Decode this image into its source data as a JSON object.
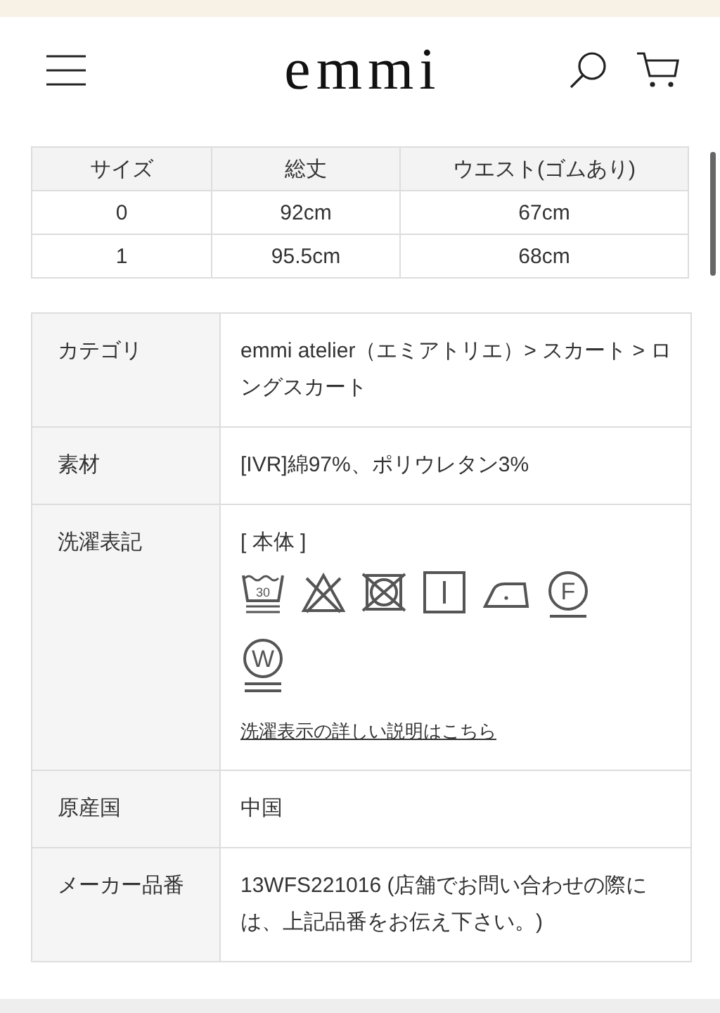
{
  "header": {
    "logo": "emmi"
  },
  "size_table": {
    "columns": [
      "サイズ",
      "総丈",
      "ウエスト(ゴムあり)"
    ],
    "rows": [
      [
        "0",
        "92cm",
        "67cm"
      ],
      [
        "1",
        "95.5cm",
        "68cm"
      ]
    ]
  },
  "details": [
    {
      "kind": "text",
      "label": "カテゴリ",
      "value": "emmi atelier（エミアトリエ）> スカート > ロングスカート"
    },
    {
      "kind": "text",
      "label": "素材",
      "value": "[IVR]綿97%、ポリウレタン3%"
    },
    {
      "kind": "care",
      "label": "洗濯表記",
      "section": "[ 本体 ]",
      "symbols": [
        {
          "kind": "wash",
          "label": "30"
        },
        {
          "kind": "no-bleach"
        },
        {
          "kind": "no-tumble"
        },
        {
          "kind": "line-dry"
        },
        {
          "kind": "iron"
        },
        {
          "kind": "circle-bar",
          "label": "F"
        },
        {
          "kind": "circle-double-bar",
          "label": "W"
        }
      ],
      "link": "洗濯表示の詳しい説明はこちら"
    },
    {
      "kind": "text",
      "label": "原産国",
      "value": "中国"
    },
    {
      "kind": "text",
      "label": "メーカー品番",
      "value": "13WFS221016 (店舗でお問い合わせの際には、上記品番をお伝え下さい。)"
    }
  ]
}
